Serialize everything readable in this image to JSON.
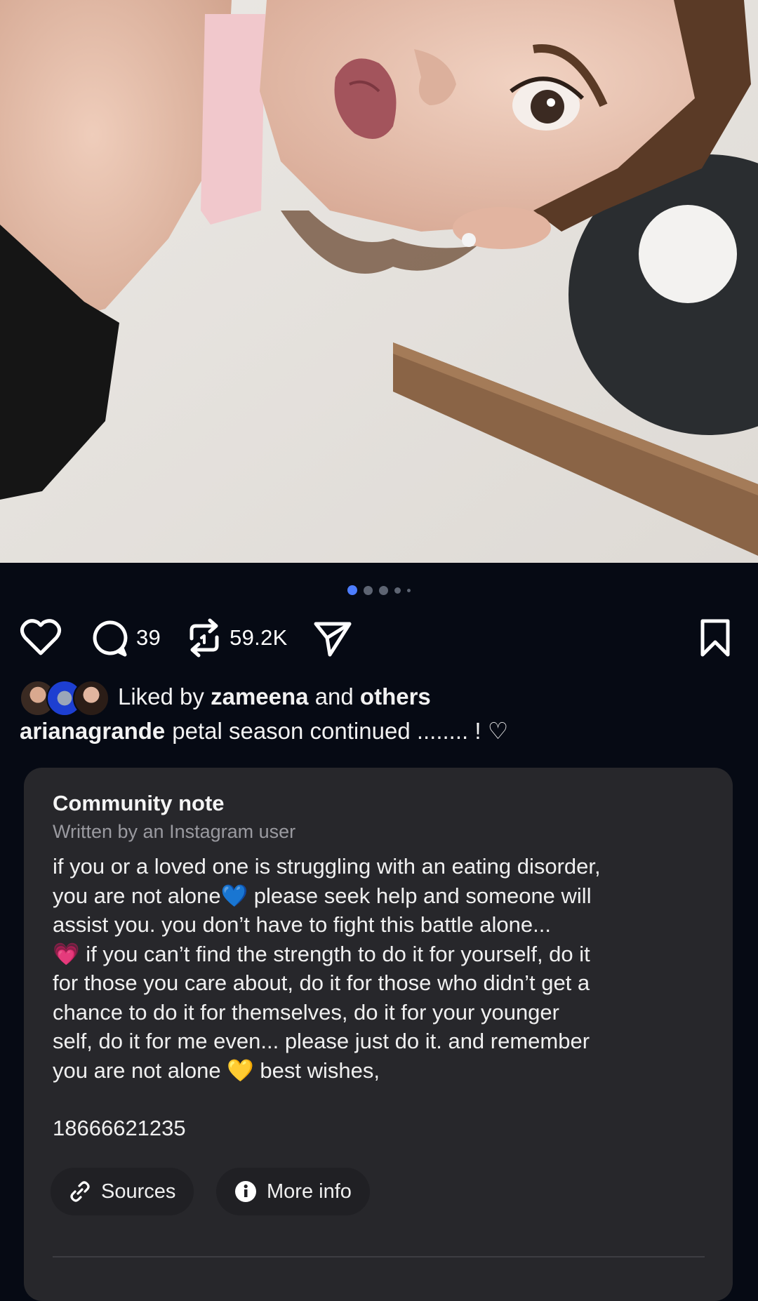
{
  "post": {
    "photo_alt": "photo",
    "carousel": {
      "count": 5,
      "active_index": 0
    }
  },
  "actions": {
    "comments_count": "39",
    "reposts_count": "59.2K"
  },
  "liked_by": {
    "prefix": "Liked by",
    "user": "zameena",
    "conjunction": "and",
    "others": "others"
  },
  "caption": {
    "username": "arianagrande",
    "text": "petal season continued ........ ! ♡"
  },
  "community_note": {
    "title": "Community note",
    "subtitle": "Written by an Instagram user",
    "body": "if you or a loved one is struggling with an eating disorder,\nyou are not alone💙 please seek help and someone will\nassist you. you don’t have to fight this battle alone...\n💗 if you can’t find the strength to do it for yourself, do it\nfor those you care about, do it for those who didn’t get a\nchance to do it for themselves, do it for your younger\nself, do it for me even... please just do it. and remember\nyou are not alone 💛 best wishes,",
    "phone": "18666621235",
    "sources_label": "Sources",
    "more_info_label": "More info"
  },
  "colors": {
    "background": "#060a14",
    "card": "#27272b",
    "accent_dot": "#4d7dff"
  },
  "icons": [
    "heart-icon",
    "comment-icon",
    "repost-icon",
    "share-icon",
    "bookmark-icon",
    "link-icon",
    "info-icon"
  ]
}
